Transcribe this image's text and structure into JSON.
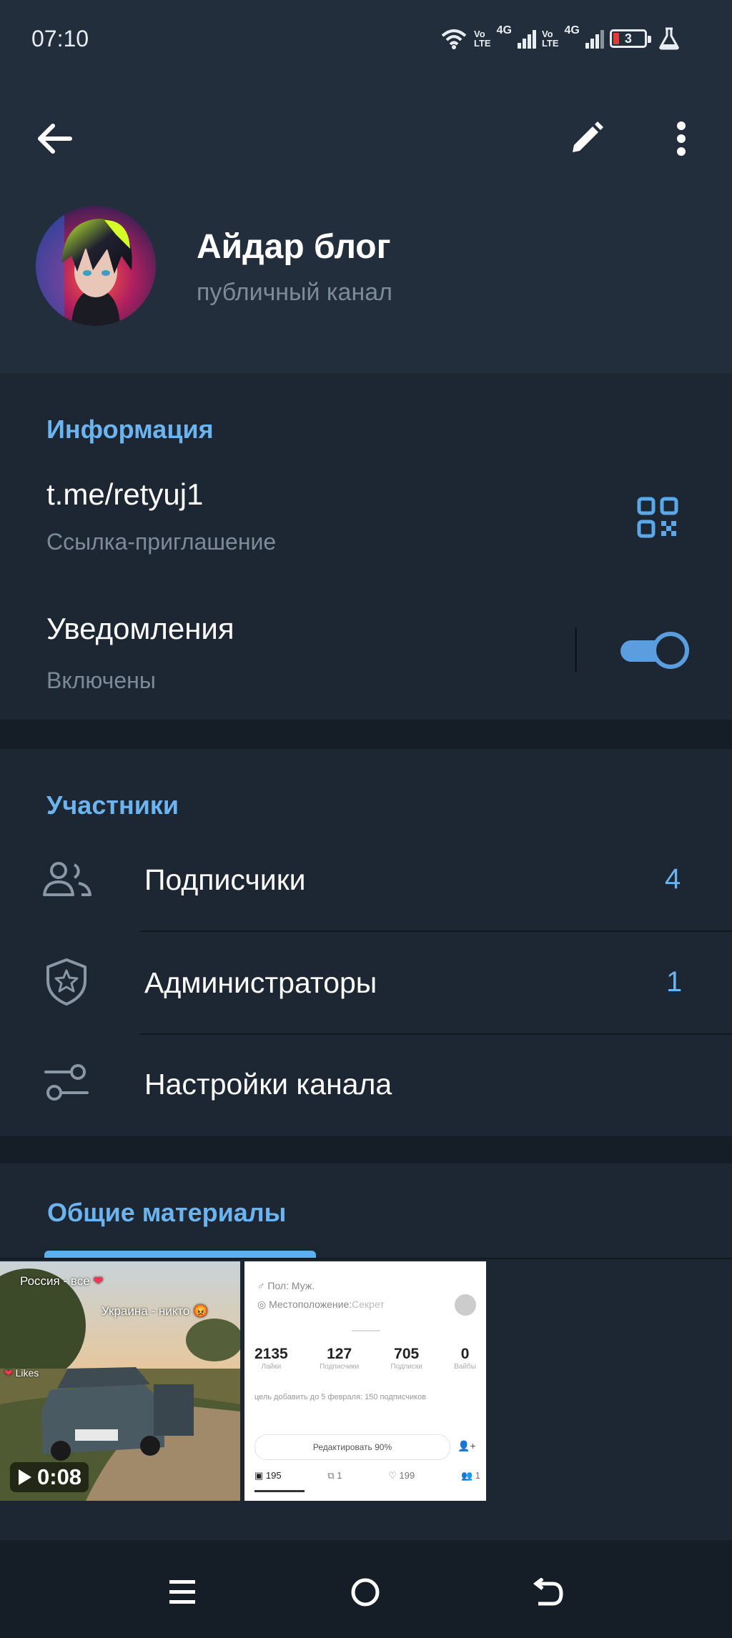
{
  "status_bar": {
    "time": "07:10",
    "network1": {
      "top": "Vo",
      "bottom": "LTE",
      "type": "4G"
    },
    "network2": {
      "top": "Vo",
      "bottom": "LTE",
      "type": "4G"
    },
    "battery": "3"
  },
  "header": {
    "channel_name": "Айдар блог",
    "channel_status": "публичный канал"
  },
  "info": {
    "title": "Информация",
    "link": "t.me/retyuj1",
    "link_caption": "Ссылка-приглашение",
    "notifications_label": "Уведомления",
    "notifications_state": "Включены",
    "notifications_on": true
  },
  "members": {
    "title": "Участники",
    "subscribers_label": "Подписчики",
    "subscribers_count": "4",
    "admins_label": "Администраторы",
    "admins_count": "1",
    "settings_label": "Настройки канала"
  },
  "shared": {
    "title": "Общие материалы",
    "video": {
      "duration": "0:08",
      "caption1": "Россия - все",
      "caption2": "Украина - никто",
      "likes_label": "Likes"
    },
    "screenshot": {
      "line1": "Пол: Муж.",
      "line2": "Местоположение:",
      "line2_value": "Секрет",
      "stats": [
        {
          "value": "2135",
          "label": "Лайки"
        },
        {
          "value": "127",
          "label": "Подписчики"
        },
        {
          "value": "705",
          "label": "Подписки"
        },
        {
          "value": "0",
          "label": "Вайбы"
        }
      ],
      "desc": "цель добавить до 5 февраля: 150 подписчиков",
      "button": "Редактировать 90%",
      "tabs": [
        "195",
        "1",
        "199",
        "1"
      ]
    }
  },
  "colors": {
    "accent": "#6cb4f0",
    "header_bg": "#232e3c",
    "section_bg": "#1d2733",
    "page_bg": "#151e27"
  }
}
